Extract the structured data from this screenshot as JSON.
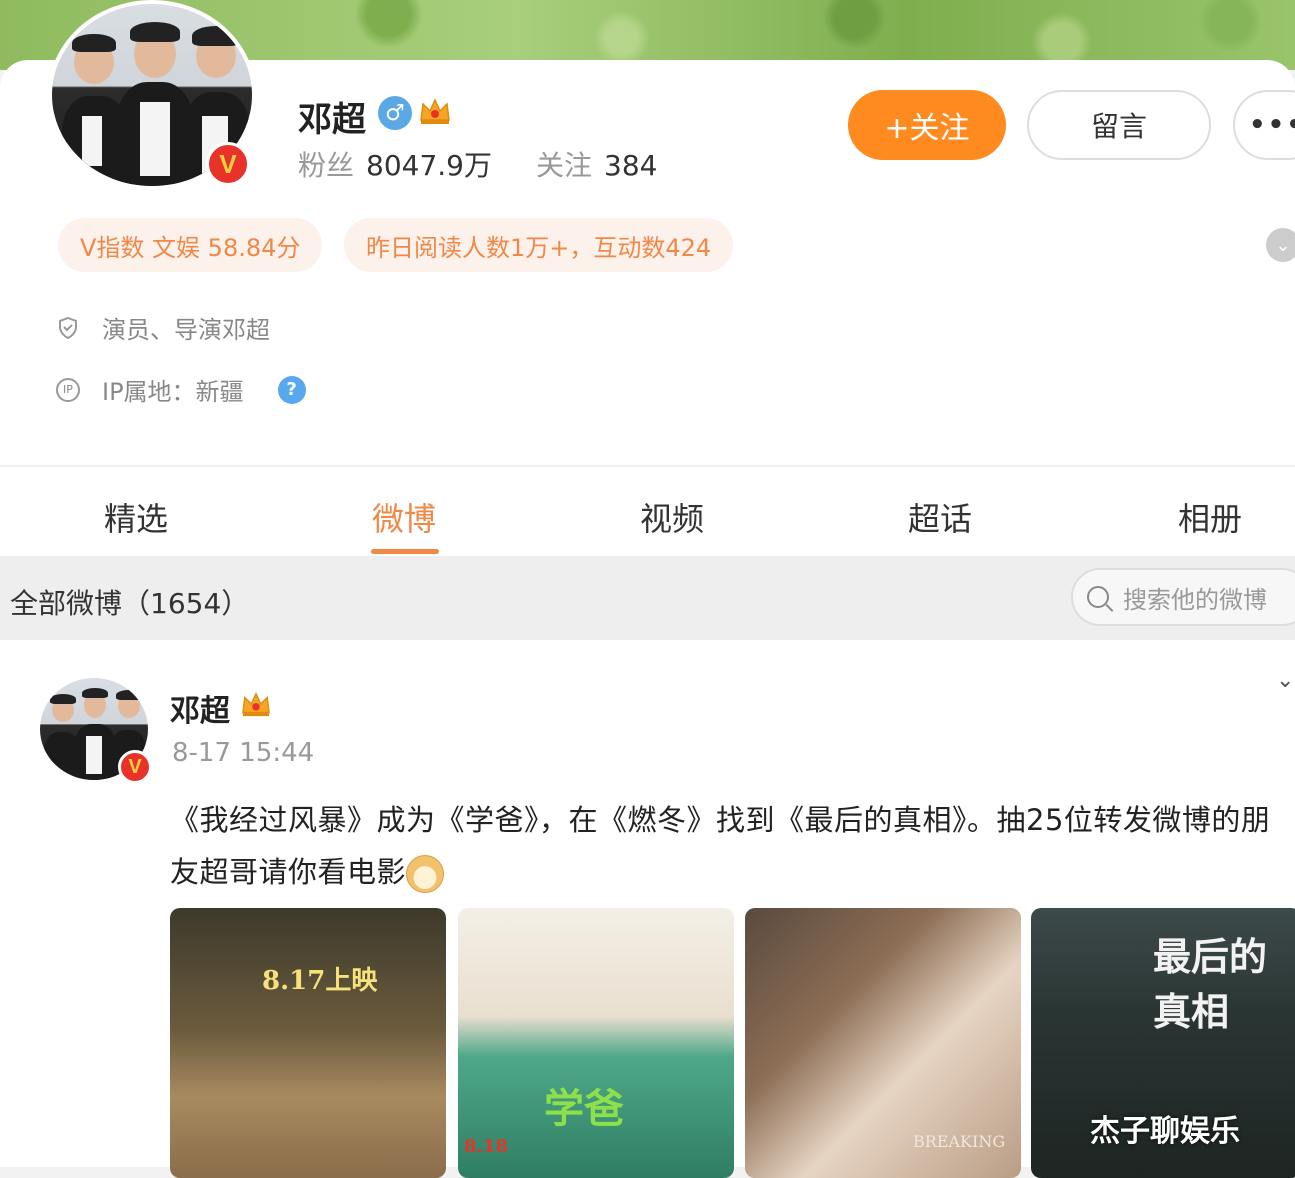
{
  "profile": {
    "name": "邓超",
    "gender_icon": "♂",
    "fans_label": "粉丝",
    "fans_value": "8047.9万",
    "follow_label": "关注",
    "follow_value": "384",
    "follow_button": "+关注",
    "message_button": "留言",
    "more_button": "•••",
    "verified_badge": "V",
    "tags": [
      "V指数 文娱 58.84分",
      "昨日阅读人数1万+，互动数424"
    ],
    "bio": "演员、导演邓超",
    "ip_location": "IP属地：新疆",
    "ip_icon_text": "IP",
    "help_icon": "?",
    "expand_icon": "⌄"
  },
  "tabs": [
    "精选",
    "微博",
    "视频",
    "超话",
    "相册"
  ],
  "active_tab": "微博",
  "filter": {
    "title": "全部微博（1654）",
    "search_placeholder": "搜索他的微博"
  },
  "post": {
    "author": "邓超",
    "time": "8-17 15:44",
    "text": "《我经过风暴》成为《学爸》，在《燃冬》找到《最后的真相》。抽25位转发微博的朋友超哥请你看电影",
    "chevron": "⌄",
    "posters": [
      {
        "headline": "8.17上映",
        "bottom": ""
      },
      {
        "headline": "学爸",
        "bottom": "8.18"
      },
      {
        "headline": "",
        "bottom": "BREAKING"
      },
      {
        "headline": "最后的真相",
        "bottom": ""
      }
    ]
  },
  "watermark": "杰子聊娱乐",
  "colors": {
    "accent": "#f08848",
    "follow": "#ff8a1f",
    "verified": "#e8322a",
    "info_blue": "#57a8ee"
  }
}
